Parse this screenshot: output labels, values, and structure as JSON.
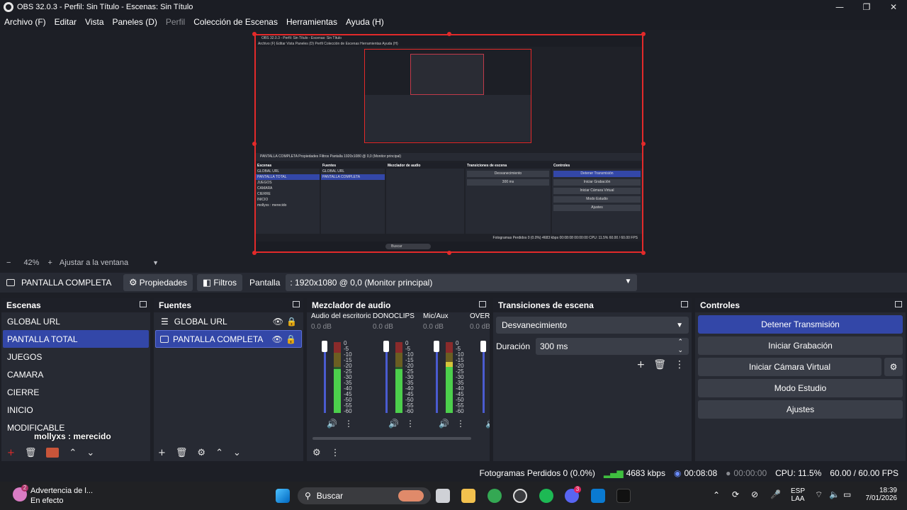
{
  "window": {
    "title": "OBS 32.0.3 - Perfil: Sin Título - Escenas: Sin Título",
    "minimize": "—",
    "maximize": "❐",
    "close": "✕"
  },
  "menu": [
    {
      "label": "Archivo (F)",
      "enabled": true
    },
    {
      "label": "Editar",
      "enabled": true
    },
    {
      "label": "Vista",
      "enabled": true
    },
    {
      "label": "Paneles (D)",
      "enabled": true
    },
    {
      "label": "Perfil",
      "enabled": false
    },
    {
      "label": "Colección de Escenas",
      "enabled": true
    },
    {
      "label": "Herramientas",
      "enabled": true
    },
    {
      "label": "Ayuda (H)",
      "enabled": true
    }
  ],
  "zoom": {
    "minus": "−",
    "value": "42%",
    "plus": "+",
    "fit_label": "Ajustar a la ventana",
    "caret": "▼"
  },
  "source_bar": {
    "source_name": "PANTALLA COMPLETA",
    "properties_label": "Propiedades",
    "filters_label": "Filtros",
    "screen_label": "Pantalla",
    "screen_value": ": 1920x1080 @ 0,0 (Monitor principal)"
  },
  "scenes": {
    "title": "Escenas",
    "items": [
      "GLOBAL URL",
      "PANTALLA TOTAL",
      "JUEGOS",
      "CAMARA",
      "CIERRE",
      "INICIO",
      "MODIFICABLE"
    ],
    "selected": "PANTALLA TOTAL"
  },
  "sources": {
    "title": "Fuentes",
    "items": [
      {
        "label": "GLOBAL URL",
        "icon": "list-icon",
        "selected": false
      },
      {
        "label": "PANTALLA COMPLETA",
        "icon": "monitor-icon",
        "selected": true
      }
    ]
  },
  "mixer": {
    "title": "Mezclador de audio",
    "channels": [
      {
        "name": "Audio del escritorio",
        "db": "0.0 dB",
        "level": 0.62
      },
      {
        "name": "DONOCLIPS",
        "db": "0.0 dB",
        "level": 0.62
      },
      {
        "name": "Mic/Aux",
        "db": "0.0 dB",
        "level": 0.72
      },
      {
        "name": "OVERL",
        "db": "0.0 dB",
        "level": 0.5
      }
    ],
    "scale": [
      "0",
      "-5",
      "-10",
      "-15",
      "-20",
      "-25",
      "-30",
      "-35",
      "-40",
      "-45",
      "-50",
      "-55",
      "-60"
    ]
  },
  "transitions": {
    "title": "Transiciones de escena",
    "selected": "Desvanecimiento",
    "duration_label": "Duración",
    "duration_value": "300 ms"
  },
  "controls": {
    "title": "Controles",
    "buttons": [
      {
        "label": "Detener Transmisión",
        "primary": true
      },
      {
        "label": "Iniciar Grabación",
        "primary": false
      },
      {
        "label": "Iniciar Cámara Virtual",
        "primary": false
      },
      {
        "label": "Modo Estudio",
        "primary": false
      },
      {
        "label": "Ajustes",
        "primary": false
      }
    ]
  },
  "overlay": {
    "chat_text": "mollyxs : merecido"
  },
  "status": {
    "dropped": "Fotogramas Perdidos 0 (0.0%)",
    "bitrate": "4683 kbps",
    "stream_time": "00:08:08",
    "rec_time": "00:00:00",
    "cpu": "CPU: 11.5%",
    "fps": "60.00 / 60.00 FPS"
  },
  "taskbar": {
    "notification_title": "Advertencia de l...",
    "notification_sub": "En efecto",
    "notification_badge": "2",
    "search_placeholder": "Buscar",
    "lang_top": "ESP",
    "lang_bottom": "LAA",
    "time": "18:39",
    "date": "7/01/2026",
    "discord_badge": "3"
  },
  "colors": {
    "accent": "#3347a8",
    "selection_border": "#e32a2a",
    "panel_bg": "#272a33",
    "window_bg": "#1d1f26"
  },
  "nested_preview": {
    "title": "OBS 32.0.3 - Perfil: Sin Título - Escenas: Sin Título",
    "menu": "Archivo (F)    Editar    Vista    Paneles (D)    Perfil    Colección de Escenas    Herramientas    Ayuda (H)",
    "source_bar": "PANTALLA COMPLETA        Propiedades    Filtros    Pantalla    1920x1080 @ 0,0 (Monitor principal)",
    "status": "Fotogramas Perdidos 0 (0.0%)   4683 kbps   00:08:08   00:00:00   CPU: 11.5%   60.00 / 60.00 FPS",
    "search": "Buscar",
    "chat": "mollyxs : merecido"
  }
}
